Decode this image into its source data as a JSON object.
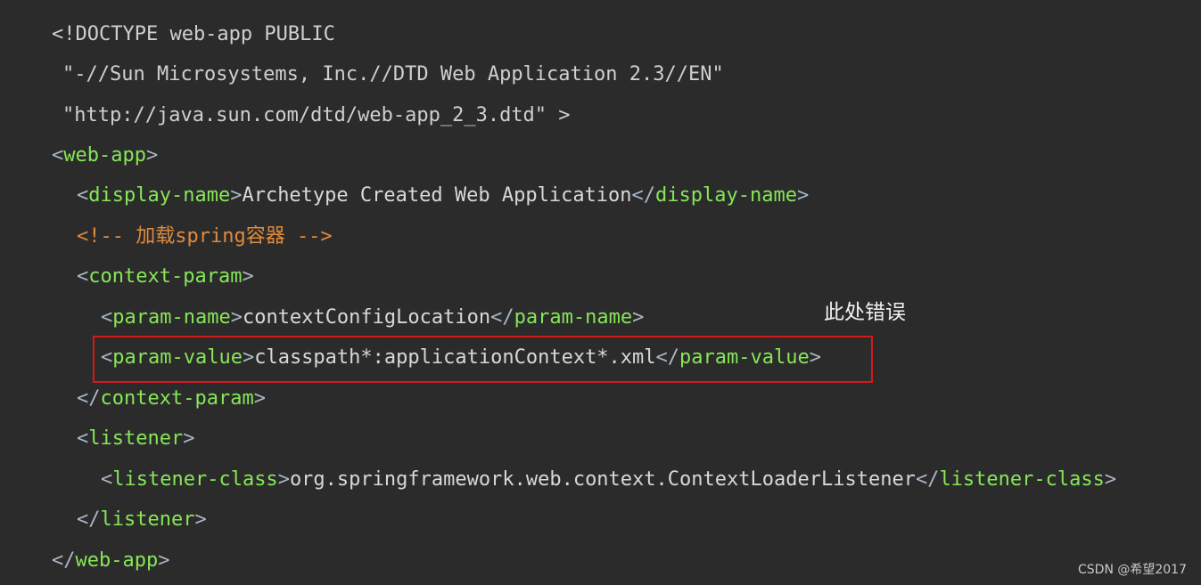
{
  "code": {
    "doctype_line": "<!DOCTYPE web-app PUBLIC",
    "doctype_public_id": "\"-//Sun Microsystems, Inc.//DTD Web Application 2.3//EN\"",
    "doctype_system_id": "\"http://java.sun.com/dtd/web-app_2_3.dtd\" >",
    "web_app_tag": "web-app",
    "display_name_tag": "display-name",
    "display_name_value": "Archetype Created Web Application",
    "comment": "<!-- 加载spring容器 -->",
    "context_param_tag": "context-param",
    "param_name_tag": "param-name",
    "param_name_value": "contextConfigLocation",
    "param_value_tag": "param-value",
    "param_value_value": "classpath*:applicationContext*.xml",
    "listener_tag": "listener",
    "listener_class_tag": "listener-class",
    "listener_class_value": "org.springframework.web.context.ContextLoaderListener"
  },
  "annotation": {
    "note": "此处错误"
  },
  "watermark": "CSDN @希望2017",
  "colors": {
    "background": "#2b2b2b",
    "tag": "#86e657",
    "comment": "#e08a3c",
    "highlight_border": "#d21a1a"
  }
}
